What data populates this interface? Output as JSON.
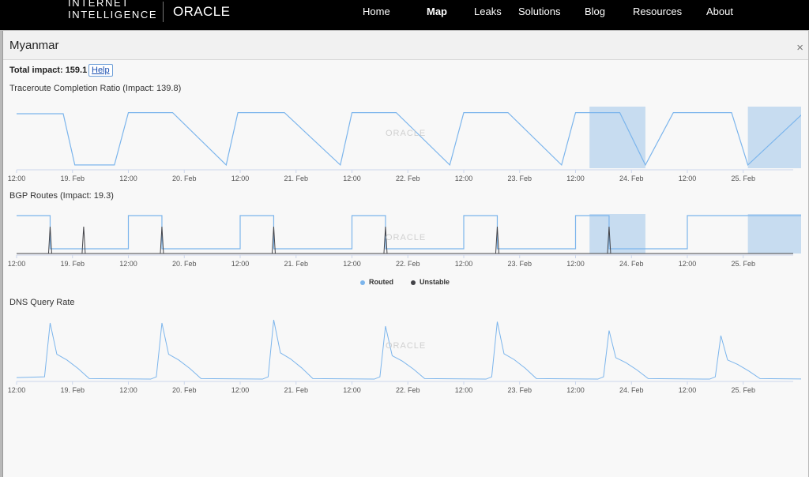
{
  "nav": {
    "brand_line1": "INTERNET",
    "brand_line2": "INTELLIGENCE",
    "brand_oracle": "ORACLE",
    "items": [
      "Home",
      "Map",
      "Leaks",
      "Solutions",
      "Blog",
      "Resources",
      "About"
    ],
    "active": "Map"
  },
  "modal": {
    "title": "Myanmar",
    "close": "×",
    "total_impact": "Total impact: 159.1",
    "help": "Help",
    "watermark": "ORACLE"
  },
  "x_ticks": [
    "12:00",
    "19. Feb",
    "12:00",
    "20. Feb",
    "12:00",
    "21. Feb",
    "12:00",
    "22. Feb",
    "12:00",
    "23. Feb",
    "12:00",
    "24. Feb",
    "12:00",
    "25. Feb"
  ],
  "legend": {
    "routed": "Routed",
    "unstable": "Unstable"
  },
  "colors": {
    "line": "#7cb5ec",
    "unstable": "#434348",
    "band": "#c7dcf0"
  },
  "chart_data": [
    {
      "type": "line",
      "title": "Traceroute Completion Ratio (Impact: 139.8)",
      "x_range_days": [
        "2019-02-18 12:00",
        "2019-02-25 24:00"
      ],
      "grid": false,
      "shaded_outages": [
        [
          "2019-02-23 15:00",
          "2019-02-24 03:00"
        ],
        [
          "2019-02-25 01:00",
          "2019-02-25 13:00"
        ]
      ],
      "series": [
        {
          "description_pattern": "daily cycle high/low",
          "x": [
            "2019-02-18 12:00",
            "2019-02-18 22:00",
            "2019-02-19 00:30",
            "2019-02-19 09:00",
            "2019-02-19 12:00",
            "2019-02-19 21:30",
            "2019-02-20 09:00",
            "2019-02-20 11:30",
            "2019-02-20 21:30",
            "2019-02-21 09:30",
            "2019-02-21 12:00",
            "2019-02-21 21:30",
            "2019-02-22 09:00",
            "2019-02-22 12:00",
            "2019-02-22 21:30",
            "2019-02-23 09:00",
            "2019-02-23 12:00",
            "2019-02-23 21:30",
            "2019-02-24 03:00",
            "2019-02-24 09:00",
            "2019-02-24 12:00",
            "2019-02-24 21:30",
            "2019-02-25 01:00",
            "2019-02-25 13:00",
            "2019-02-25 20:00"
          ],
          "y": [
            0.95,
            0.95,
            0.03,
            0.03,
            0.97,
            0.97,
            0.03,
            0.97,
            0.97,
            0.03,
            0.97,
            0.97,
            0.03,
            0.97,
            0.97,
            0.03,
            0.97,
            0.97,
            0.03,
            0.97,
            0.97,
            0.97,
            0.03,
            0.97,
            0.97
          ]
        }
      ]
    },
    {
      "type": "line",
      "title": "BGP Routes (Impact: 19.3)",
      "series": [
        {
          "name": "Routed",
          "y_high": 1.0,
          "y_low": 0.1
        },
        {
          "name": "Unstable",
          "spikes_at_day_fraction": [
            0.8,
            1.1,
            1.8,
            2.8,
            3.8,
            4.8,
            5.8
          ]
        }
      ],
      "shaded_outages": [
        [
          "2019-02-23 15:00",
          "2019-02-24 03:00"
        ],
        [
          "2019-02-25 01:00",
          "2019-02-25 13:00"
        ]
      ]
    },
    {
      "type": "line",
      "title": "DNS Query Rate",
      "series": [
        {
          "peaks_daily": [
            0.9,
            0.9,
            0.95,
            0.85,
            0.92,
            0.78,
            0.7
          ],
          "baseline": 0.12
        }
      ]
    }
  ]
}
